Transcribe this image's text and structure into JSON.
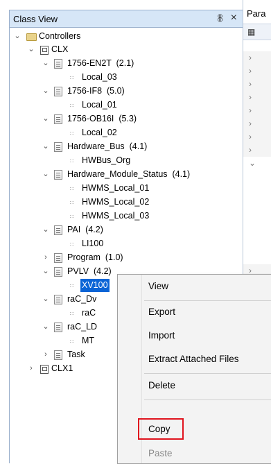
{
  "class_view": {
    "title": "Class View",
    "pin_icon": "pin-icon",
    "close_icon": "close-icon"
  },
  "tree": [
    {
      "label": "Controllers",
      "icon": "folder-icon",
      "expanded": true
    },
    {
      "label": "CLX",
      "icon": "controller-icon",
      "expanded": true
    },
    {
      "label": "1756-EN2T  (2.1)",
      "icon": "module-icon",
      "expanded": true
    },
    {
      "label": "Local_03",
      "icon": "instance-icon"
    },
    {
      "label": "1756-IF8  (5.0)",
      "icon": "module-icon",
      "expanded": true
    },
    {
      "label": "Local_01",
      "icon": "instance-icon"
    },
    {
      "label": "1756-OB16I  (5.3)",
      "icon": "module-icon",
      "expanded": true
    },
    {
      "label": "Local_02",
      "icon": "instance-icon"
    },
    {
      "label": "Hardware_Bus  (4.1)",
      "icon": "module-icon",
      "expanded": true
    },
    {
      "label": "HWBus_Org",
      "icon": "instance-icon"
    },
    {
      "label": "Hardware_Module_Status  (4.1)",
      "icon": "module-icon",
      "expanded": true
    },
    {
      "label": "HWMS_Local_01",
      "icon": "instance-icon"
    },
    {
      "label": "HWMS_Local_02",
      "icon": "instance-icon"
    },
    {
      "label": "HWMS_Local_03",
      "icon": "instance-icon"
    },
    {
      "label": "PAI  (4.2)",
      "icon": "module-icon",
      "expanded": true
    },
    {
      "label": "LI100",
      "icon": "instance-icon"
    },
    {
      "label": "Program  (1.0)",
      "icon": "module-icon",
      "expanded": false
    },
    {
      "label": "PVLV  (4.2)",
      "icon": "module-icon",
      "expanded": true
    },
    {
      "label": "XV100",
      "icon": "instance-icon",
      "selected": true
    },
    {
      "label": "raC_Dv",
      "icon": "module-icon",
      "expanded": true
    },
    {
      "label": "raC",
      "icon": "instance-icon"
    },
    {
      "label": "raC_LD",
      "icon": "module-icon",
      "expanded": true
    },
    {
      "label": "MT",
      "icon": "instance-icon"
    },
    {
      "label": "Task",
      "icon": "module-icon",
      "expanded": false
    },
    {
      "label": "CLX1",
      "icon": "controller-icon",
      "expanded": false
    }
  ],
  "para_panel": {
    "title": "Para"
  },
  "context_menu": {
    "items": [
      {
        "label": "View",
        "enabled": true
      },
      {
        "label": "Export",
        "enabled": true
      },
      {
        "label": "Import",
        "enabled": true
      },
      {
        "label": "Extract Attached Files",
        "enabled": true
      },
      {
        "label": "Delete",
        "enabled": true
      },
      {
        "label": "Copy",
        "enabled": true,
        "highlighted": true
      },
      {
        "label": "Paste",
        "enabled": false
      }
    ],
    "highlight_color": "#e0141e"
  },
  "colors": {
    "selection": "#0a64d6",
    "header_bg": "#d6e6f7"
  }
}
